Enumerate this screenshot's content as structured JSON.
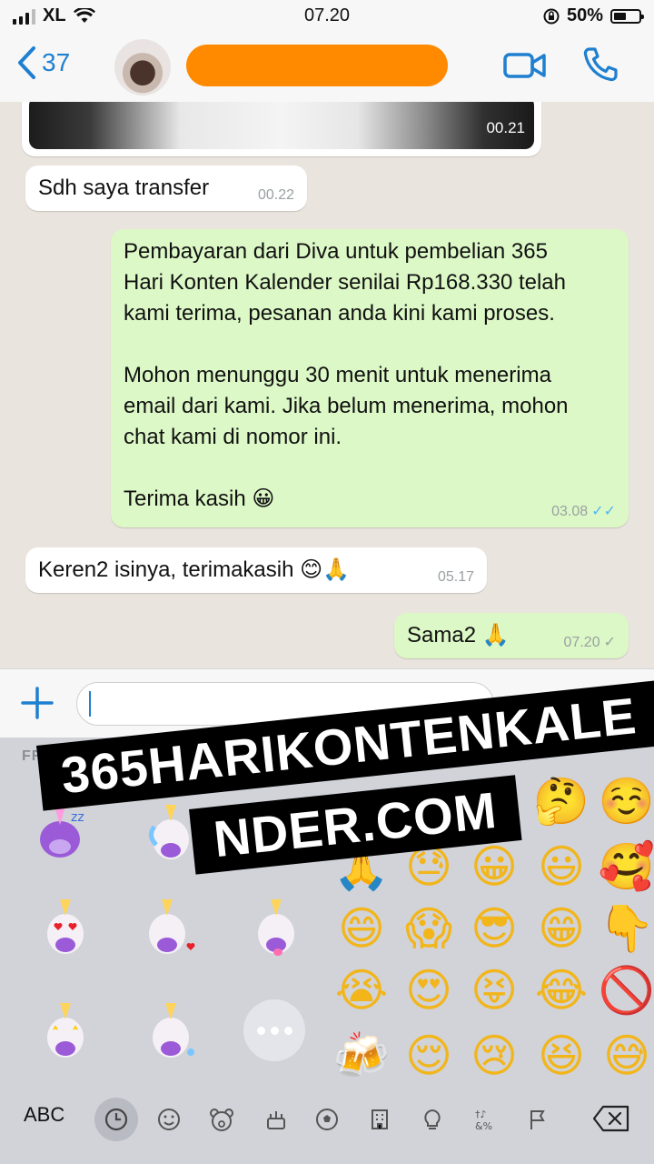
{
  "status_bar": {
    "carrier": "XL",
    "time": "07.20",
    "battery": "50%",
    "battery_level": 0.5
  },
  "header": {
    "back_count": "37",
    "contact_name": ""
  },
  "messages": [
    {
      "type": "video",
      "time": "00.21"
    },
    {
      "direction": "in",
      "text": "Sdh saya transfer",
      "time": "00.22"
    },
    {
      "direction": "out",
      "lines": [
        "Pembayaran dari Diva untuk pembelian 365",
        "Hari Konten Kalender senilai Rp168.330 telah",
        "kami terima, pesanan anda kini kami proses.",
        "",
        "Mohon menunggu 30 menit untuk menerima",
        "email dari kami. Jika belum menerima, mohon",
        "chat kami di nomor ini.",
        "",
        "Terima kasih 😀"
      ],
      "time": "03.08",
      "status": "read"
    },
    {
      "direction": "in",
      "text": "Keren2 isinya, terimakasih 😊🙏",
      "time": "05.17"
    },
    {
      "direction": "out",
      "text": "Sama2 🙏",
      "time": "07.20",
      "status": "sent"
    }
  ],
  "input": {
    "placeholder": "",
    "value": ""
  },
  "keyboard": {
    "section_label": "FREQUENTLY USED",
    "emoji_grid": [
      [
        "😗",
        "🤔",
        "☺️"
      ],
      [
        "🙏",
        "😓",
        "😀",
        "😃",
        "🥰"
      ],
      [
        "😄",
        "😱",
        "😎",
        "😁",
        "👇"
      ],
      [
        "😭",
        "😍",
        "😝",
        "😂",
        "🚫"
      ],
      [
        "🍻",
        "😌",
        "😢",
        "😆",
        "😅"
      ]
    ],
    "abc_label": "ABC"
  },
  "watermark": {
    "line1": "365HARIKONTENKALE",
    "line2": "NDER.COM"
  }
}
